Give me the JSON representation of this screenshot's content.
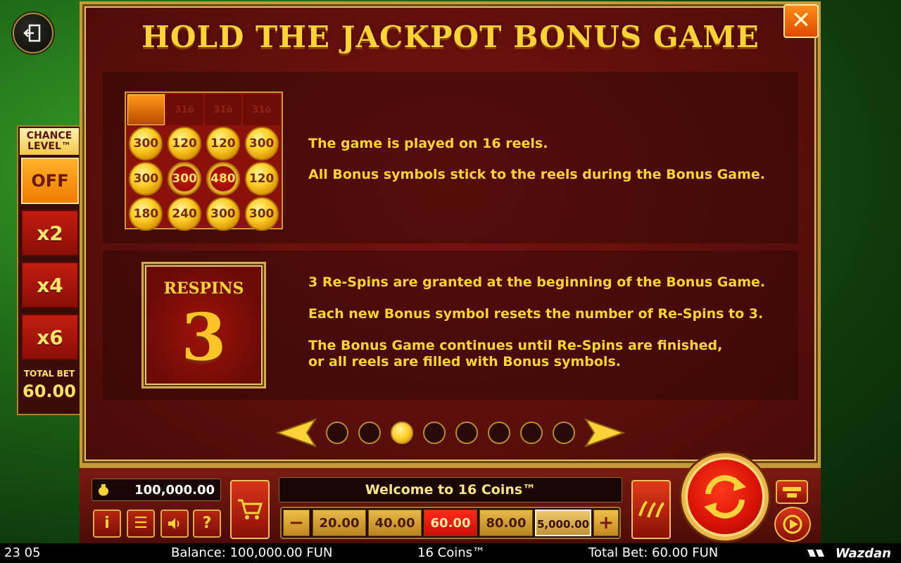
{
  "title": "HOLD THE JACKPOT BONUS GAME",
  "chance_level": {
    "title_line1": "CHANCE",
    "title_line2": "LEVEL™",
    "options": [
      "OFF",
      "x2",
      "x4",
      "x6"
    ],
    "active": "OFF",
    "total_bet_label": "TOTAL BET",
    "total_bet_value": "60.00"
  },
  "grid": {
    "top_row": [
      "",
      "31ō",
      "31ō",
      "31ō"
    ],
    "rows": [
      [
        "300",
        "120",
        "120",
        "300"
      ],
      [
        "300",
        "300",
        "480",
        "120"
      ],
      [
        "180",
        "240",
        "300",
        "300"
      ]
    ],
    "red_coins": [
      "1-1",
      "1-2"
    ]
  },
  "section1": {
    "line1": "The game is played on 16 reels.",
    "line2": "All Bonus symbols stick to the reels during the Bonus Game."
  },
  "respins_box": {
    "label": "RESPINS",
    "number": "3"
  },
  "section2": {
    "line1": "3 Re-Spins are granted at the beginning of the Bonus Game.",
    "line2": "Each new Bonus symbol resets the number of Re-Spins to 3.",
    "line3a": "The Bonus Game continues until Re-Spins are finished,",
    "line3b": "or all reels are filled with Bonus symbols."
  },
  "pager": {
    "pages": 8,
    "current": 3
  },
  "bottom": {
    "balance": "100,000.00",
    "welcome": "Welcome to 16 Coins™",
    "bets": [
      "20.00",
      "40.00",
      "60.00",
      "80.00",
      "5,000.00"
    ],
    "active_bet": "60.00",
    "selected_bet": "5,000.00",
    "minus": "−",
    "plus": "+",
    "info_icon_label": "i",
    "menu_icon_label": "☰",
    "help_icon_label": "?"
  },
  "status_bar": {
    "time": "23 05",
    "balance": "Balance: 100,000.00 FUN",
    "game": "16 Coins™",
    "total_bet": "Total Bet: 60.00 FUN",
    "brand": "Wazdan"
  },
  "colors": {
    "gold_text": "#ffd23a",
    "panel_red": "#5e0f0b",
    "active_bet": "#ff2a1a",
    "active_chance": "#f07b00"
  }
}
